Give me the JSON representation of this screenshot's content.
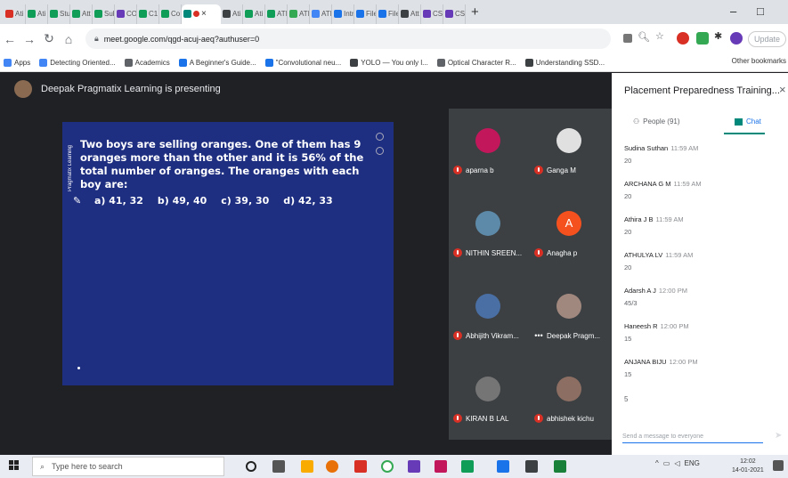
{
  "tabs": [
    {
      "label": "Ati",
      "color": "#d93025"
    },
    {
      "label": "Ati",
      "color": "#0f9d58"
    },
    {
      "label": "Stu",
      "color": "#0f9d58"
    },
    {
      "label": "Att",
      "color": "#0f9d58"
    },
    {
      "label": "Sub",
      "color": "#0f9d58"
    },
    {
      "label": "CO",
      "color": "#673ab7"
    },
    {
      "label": "C1",
      "color": "#0f9d58"
    },
    {
      "label": "Co",
      "color": "#0f9d58"
    },
    {
      "label": "Ati",
      "color": "#3c4043"
    },
    {
      "label": "Ati",
      "color": "#0f9d58"
    },
    {
      "label": "ATI",
      "color": "#0f9d58"
    },
    {
      "label": "ATI",
      "color": "#34a853"
    },
    {
      "label": "ATI",
      "color": "#4285f4"
    },
    {
      "label": "Intr",
      "color": "#1a73e8"
    },
    {
      "label": "File",
      "color": "#1a73e8"
    },
    {
      "label": "File",
      "color": "#1a73e8"
    },
    {
      "label": "Att",
      "color": "#3c4043"
    },
    {
      "label": "CSI",
      "color": "#673ab7"
    },
    {
      "label": "CSI",
      "color": "#673ab7"
    }
  ],
  "active_tab": {
    "label": "",
    "close": "×"
  },
  "new_tab": "+",
  "window": {
    "minimize": "–",
    "maximize": "□"
  },
  "address": {
    "url": "meet.google.com/qgd-acuj-aeq?authuser=0",
    "update_label": "Update"
  },
  "bookmarks": [
    {
      "label": "Apps",
      "color": "#4285f4"
    },
    {
      "label": "Detecting Oriented...",
      "color": "#4285f4"
    },
    {
      "label": "Academics",
      "color": "#5f6368"
    },
    {
      "label": "A Beginner's Guide...",
      "color": "#1a73e8"
    },
    {
      "label": "\"Convolutional neu...",
      "color": "#1a73e8"
    },
    {
      "label": "YOLO — You only l...",
      "color": "#3c4043"
    },
    {
      "label": "Optical Character R...",
      "color": "#5f6368"
    },
    {
      "label": "Understanding SSD...",
      "color": "#3c4043"
    }
  ],
  "other_bookmarks": "Other bookmarks",
  "meet": {
    "presenter_label": "Deepak Pragmatix Learning is presenting",
    "slide": {
      "question": "Two boys are selling oranges. One of them has 9 oranges more than the other and it is 56% of the total number of oranges. The oranges with each boy are:",
      "side_label": "Pragmatix Learning",
      "options": [
        "a) 41, 32",
        "b) 49, 40",
        "c) 39, 30",
        "d) 42, 33"
      ]
    },
    "participants": [
      {
        "name": "aparna b",
        "avatar_color": "#c2185b",
        "muted": true
      },
      {
        "name": "Ganga M",
        "avatar_color": "#e0e0e0",
        "muted": true
      },
      {
        "name": "NITHIN SREEN...",
        "avatar_color": "#5d8aa8",
        "muted": true
      },
      {
        "name": "Anagha p",
        "avatar_color": "#f4511e",
        "initial": "A",
        "muted": true
      },
      {
        "name": "Abhijith Vikram...",
        "avatar_color": "#4a6fa5",
        "muted": true
      },
      {
        "name": "Deepak Pragm...",
        "avatar_color": "#a1887f",
        "muted": false
      },
      {
        "name": "KIRAN B LAL",
        "avatar_color": "#757575",
        "muted": true
      },
      {
        "name": "abhishek kichu",
        "avatar_color": "#8d6e63",
        "muted": true
      }
    ]
  },
  "panel": {
    "title": "Placement Preparedness Training...",
    "close": "×",
    "people_tab": "People (91)",
    "chat_tab": "Chat",
    "messages": [
      {
        "name": "Sudina Suthan",
        "time": "11:59 AM",
        "text": "20"
      },
      {
        "name": "ARCHANA G M",
        "time": "11:59 AM",
        "text": "20"
      },
      {
        "name": "Athira J B",
        "time": "11:59 AM",
        "text": "20"
      },
      {
        "name": "ATHULYA LV",
        "time": "11:59 AM",
        "text": "20"
      },
      {
        "name": "Adarsh A J",
        "time": "12:00 PM",
        "text": "45/3"
      },
      {
        "name": "Haneesh R",
        "time": "12:00 PM",
        "text": "15"
      },
      {
        "name": "ANJANA BIJU",
        "time": "12:00 PM",
        "text": "15"
      }
    ],
    "extra_text": "5",
    "input_placeholder": "Send a message to everyone"
  },
  "taskbar": {
    "search_placeholder": "Type here to search",
    "lang": "ENG",
    "time": "12:02",
    "date": "14-01-2021"
  },
  "colors": {
    "slide_bg": "#1e2e80",
    "accent": "#00897b",
    "mic_off": "#d93025"
  }
}
